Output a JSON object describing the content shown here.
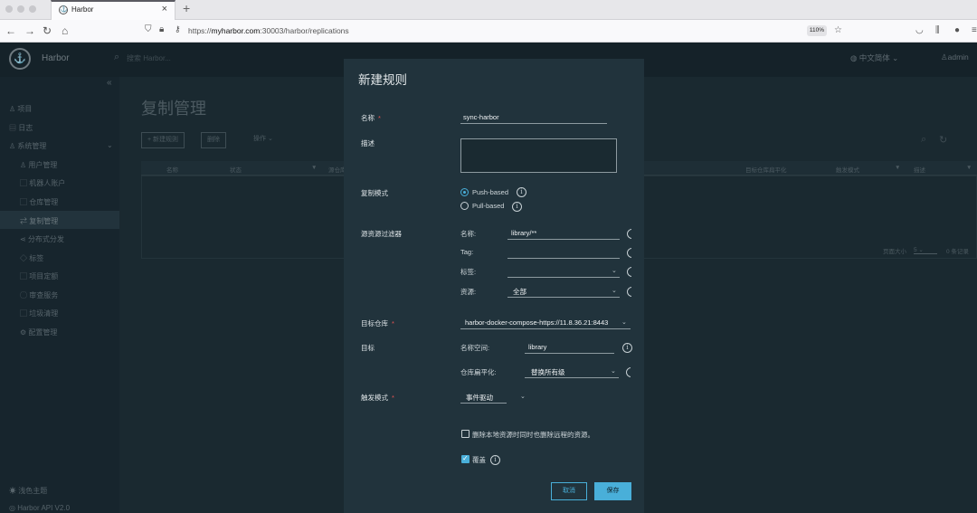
{
  "browser": {
    "tab_title": "Harbor",
    "url_prefix": "https://",
    "url_host": "myharbor.com",
    "url_path": ":30003/harbor/replications",
    "zoom": "110%"
  },
  "header": {
    "brand": "Harbor",
    "search_placeholder": "搜索 Harbor...",
    "language": "中文简体",
    "user": "admin"
  },
  "sidebar": {
    "items": [
      {
        "label": "项目"
      },
      {
        "label": "日志"
      },
      {
        "label": "系统管理"
      },
      {
        "label": "用户管理"
      },
      {
        "label": "机器人账户"
      },
      {
        "label": "仓库管理"
      },
      {
        "label": "复制管理"
      },
      {
        "label": "分布式分发"
      },
      {
        "label": "标签"
      },
      {
        "label": "项目定额"
      },
      {
        "label": "审查服务"
      },
      {
        "label": "垃圾清理"
      },
      {
        "label": "配置管理"
      }
    ],
    "theme": "浅色主题",
    "api": "Harbor API V2.0"
  },
  "page": {
    "title": "复制管理",
    "new_rule_btn": "+ 新建规则",
    "delete_btn": "删除",
    "action_btn": "操作",
    "columns": [
      "名称",
      "状态",
      "源仓库",
      "目标仓库扁平化",
      "触发模式",
      "描述"
    ],
    "pager": "页面大小",
    "page_size": "5",
    "total": "0 条记录"
  },
  "modal": {
    "title": "新建规则",
    "name_label": "名称",
    "name_value": "sync-harbor",
    "desc_label": "描述",
    "mode_label": "复制模式",
    "push_based": "Push-based",
    "pull_based": "Pull-based",
    "filter_label": "源资源过滤器",
    "filter_name_label": "名称:",
    "filter_name_value": "library/**",
    "filter_tag_label": "Tag:",
    "filter_label_label": "标签:",
    "filter_resource_label": "资源:",
    "filter_resource_value": "全部",
    "target_registry_label": "目标仓库",
    "target_registry_value": "harbor-docker-compose-https://11.8.36.21:8443",
    "target_label": "目标",
    "namespace_label": "名称空间:",
    "namespace_value": "library",
    "flatten_label": "仓库扁平化:",
    "flatten_value": "替换所有级",
    "trigger_label": "触发模式",
    "trigger_value": "事件驱动",
    "delete_remote_label": "删除本地资源时同时也删除远程的资源。",
    "override_label": "覆盖",
    "cancel": "取消",
    "save": "保存",
    "required_mark": "*",
    "accent": "#49afd9"
  }
}
